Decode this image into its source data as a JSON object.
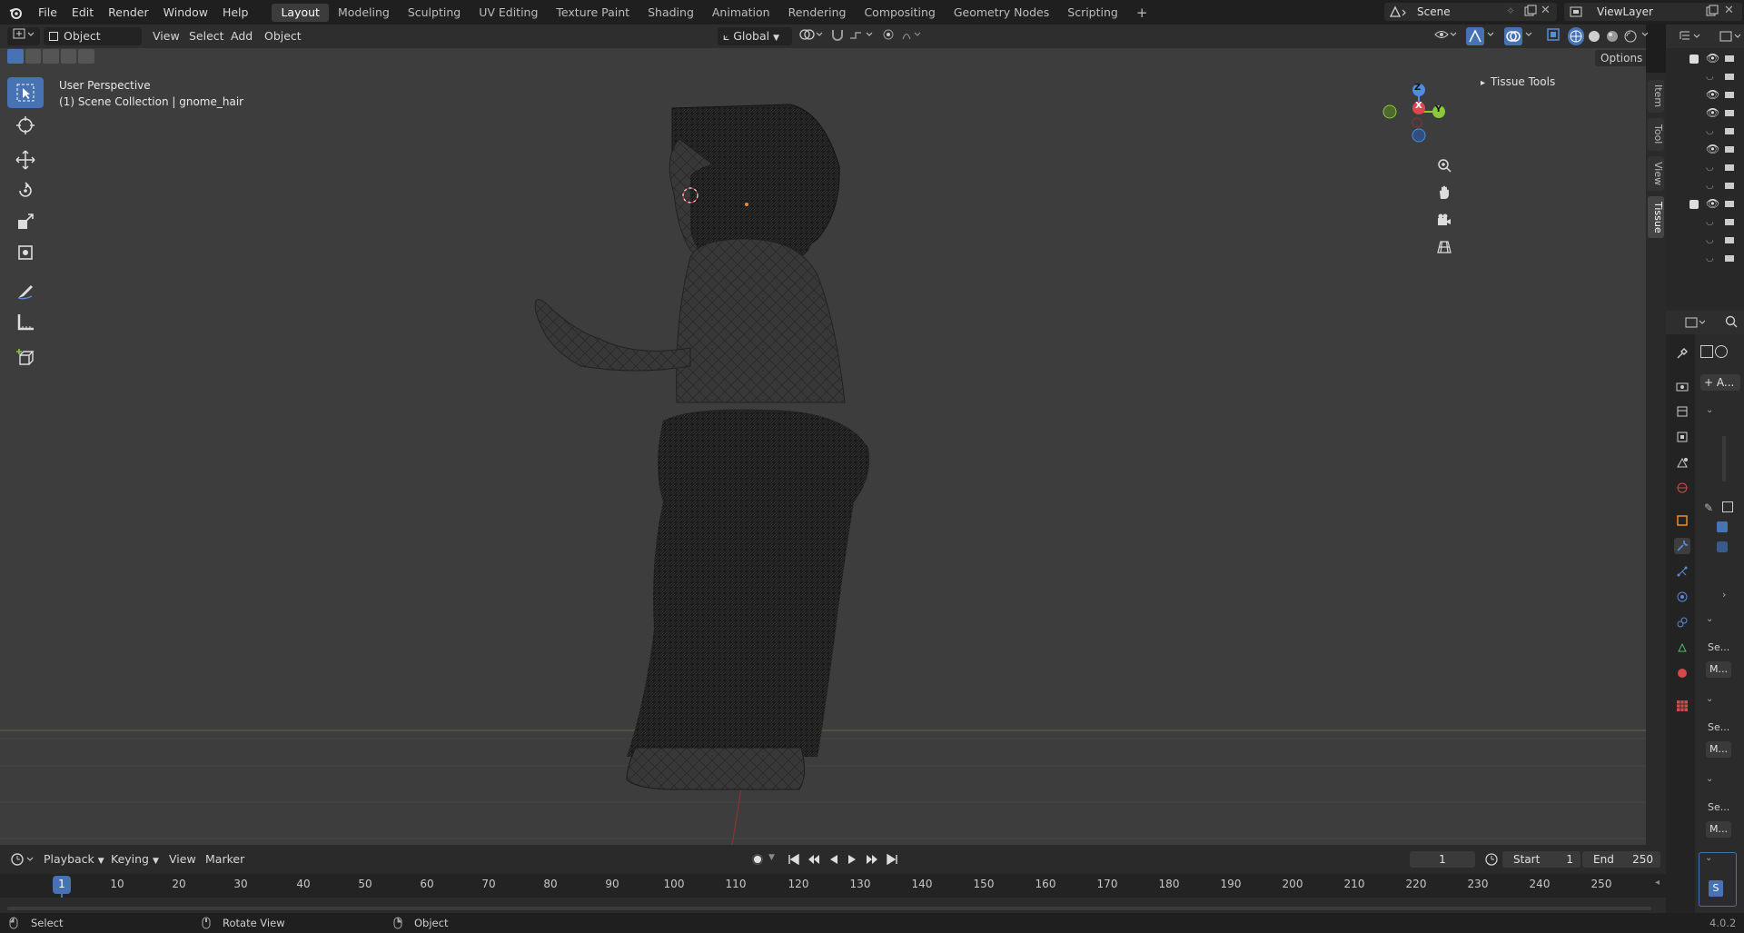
{
  "menu": {
    "items": [
      "File",
      "Edit",
      "Render",
      "Window",
      "Help"
    ],
    "workspaces": [
      "Layout",
      "Modeling",
      "Sculpting",
      "UV Editing",
      "Texture Paint",
      "Shading",
      "Animation",
      "Rendering",
      "Compositing",
      "Geometry Nodes",
      "Scripting"
    ],
    "active_workspace": "Layout",
    "add_workspace_icon": "plus-icon"
  },
  "scene": {
    "label": "Scene",
    "view_layer": "ViewLayer"
  },
  "viewport_header": {
    "mode": "Object Mode",
    "menus": [
      "View",
      "Select",
      "Add",
      "Object"
    ],
    "transform_orientation": "Global",
    "options_label": "Options"
  },
  "viewport": {
    "perspective": "User Perspective",
    "collection": "(1) Scene Collection | gnome_hair",
    "gizmo": {
      "x": "X",
      "y": "Y",
      "z": "Z"
    },
    "colors": {
      "x": "#e2434f",
      "y": "#8bc83b",
      "z": "#4e8be3",
      "bg": "#3d3d3d"
    }
  },
  "npanel": {
    "section_title": "Tissue Tools",
    "tabs": [
      "Item",
      "Tool",
      "View",
      "Tissue"
    ]
  },
  "properties": {
    "add_modifier": "A...",
    "labels": [
      "Se...",
      "M...",
      "Se...",
      "M...",
      "Se...",
      "M...",
      "S"
    ]
  },
  "timeline": {
    "menus": [
      "Playback",
      "Keying",
      "View",
      "Marker"
    ],
    "current_frame": "1",
    "start_label": "Start",
    "start_value": "1",
    "end_label": "End",
    "end_value": "250",
    "ticks": [
      "1",
      "10",
      "20",
      "30",
      "40",
      "50",
      "60",
      "70",
      "80",
      "90",
      "100",
      "110",
      "120",
      "130",
      "140",
      "150",
      "160",
      "170",
      "180",
      "190",
      "200",
      "210",
      "220",
      "230",
      "240",
      "250"
    ]
  },
  "statusbar": {
    "left_click": "Select",
    "middle_click": "Rotate View",
    "right_click": "Object",
    "version": "4.0.2"
  },
  "accent_color": "#4772b3"
}
